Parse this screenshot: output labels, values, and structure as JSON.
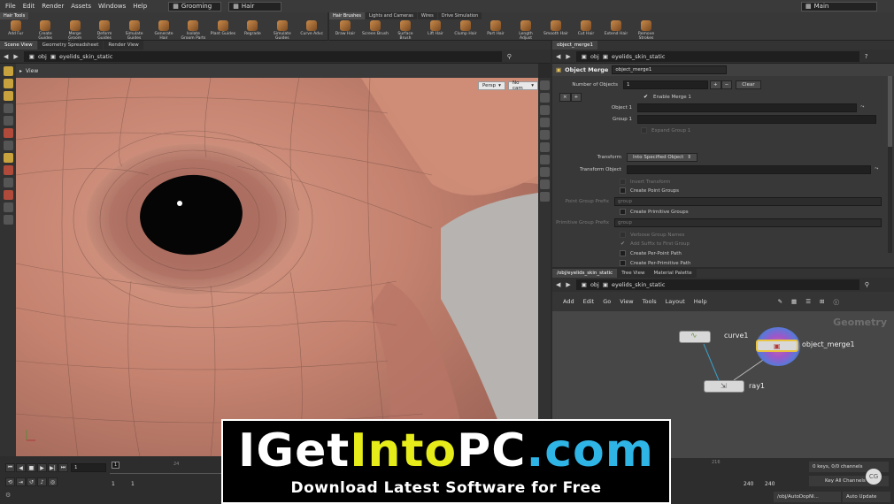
{
  "menubar": {
    "items": [
      "File",
      "Edit",
      "Render",
      "Assets",
      "Windows",
      "Help"
    ],
    "desktop": "Grooming",
    "context": "Hair",
    "main_label": "Main"
  },
  "shelf_left": {
    "tabs": [
      "Hair Tools"
    ],
    "tools": [
      "Add Fur",
      "Create Guides",
      "Merge Groom Objects",
      "Deform Guides",
      "Simulate Guides",
      "Generate Hair",
      "Isolate Groom Parts",
      "Plant Guides",
      "Regrade",
      "Simulate Guides",
      "Curve Advc"
    ]
  },
  "shelf_right": {
    "tabs": [
      "Hair Brushes",
      "Lights and Cameras",
      "Wires",
      "Drive Simulation"
    ],
    "tools": [
      "Draw Hair",
      "Screen Brush",
      "Surface Brush",
      "Lift Hair",
      "Clump Hair",
      "Part Hair",
      "Length Adjust",
      "Smooth Hair",
      "Cut Hair",
      "Extend Hair",
      "Remove Strokes"
    ]
  },
  "left_pane": {
    "tabs": [
      "Scene View",
      "Geometry Spreadsheet",
      "Render View"
    ],
    "path_obj": "obj",
    "path_node": "eyelids_skin_static",
    "view_title": "View",
    "persp": "Persp",
    "cam": "No cam"
  },
  "timeline": {
    "frame": "1",
    "start": "1",
    "start2": "1",
    "ticks": [
      "1",
      "24",
      "216"
    ],
    "end": "240",
    "end2": "240"
  },
  "right_upper": {
    "tab": "object_merge1",
    "path_obj": "obj",
    "path_node": "eyelids_skin_static",
    "node_type": "Object Merge",
    "node_name": "object_merge1",
    "num_objects_label": "Number of Objects",
    "num_objects_value": "1",
    "clear_label": "Clear",
    "enable_merge": "Enable Merge 1",
    "object1_label": "Object 1",
    "group1_label": "Group 1",
    "expand_group": "Expand Group 1",
    "transform_label": "Transform",
    "transform_value": "Into Specified Object",
    "transform_object_label": "Transform Object",
    "invert_transform": "Invert Transform",
    "create_point_groups": "Create Point Groups",
    "point_group_prefix_label": "Point Group Prefix",
    "point_group_prefix_value": "group",
    "create_primitive_groups": "Create Primitive Groups",
    "primitive_group_prefix_label": "Primitive Group Prefix",
    "primitive_group_prefix_value": "group",
    "verbose_group_names": "Verbose Group Names",
    "add_suffix": "Add Suffix to First Group",
    "create_per_point_path": "Create Per-Point Path",
    "create_per_primitive_path": "Create Per-Primitive Path"
  },
  "network": {
    "tabs": [
      "/obj/eyelids_skin_static",
      "Tree View",
      "Material Palette"
    ],
    "path_obj": "obj",
    "path_node": "eyelids_skin_static",
    "menu": [
      "Add",
      "Edit",
      "Go",
      "View",
      "Tools",
      "Layout",
      "Help"
    ],
    "context_label": "Geometry",
    "nodes": [
      "curve1",
      "object_merge1",
      "ray1"
    ],
    "keys_text": "0 keys, 0/0 channels",
    "key_all_channels": "Key All Channels",
    "auto_path": "/obj/AutoDopNl...",
    "auto_update": "Auto Update"
  },
  "watermark": {
    "title_parts": [
      "IGet",
      "Into",
      "PC",
      ".com"
    ],
    "subtitle": "Download Latest Software for Free",
    "colors": {
      "white": "#ffffff",
      "yellow": "#e6ec1a",
      "cyan": "#2fb4e6"
    }
  }
}
